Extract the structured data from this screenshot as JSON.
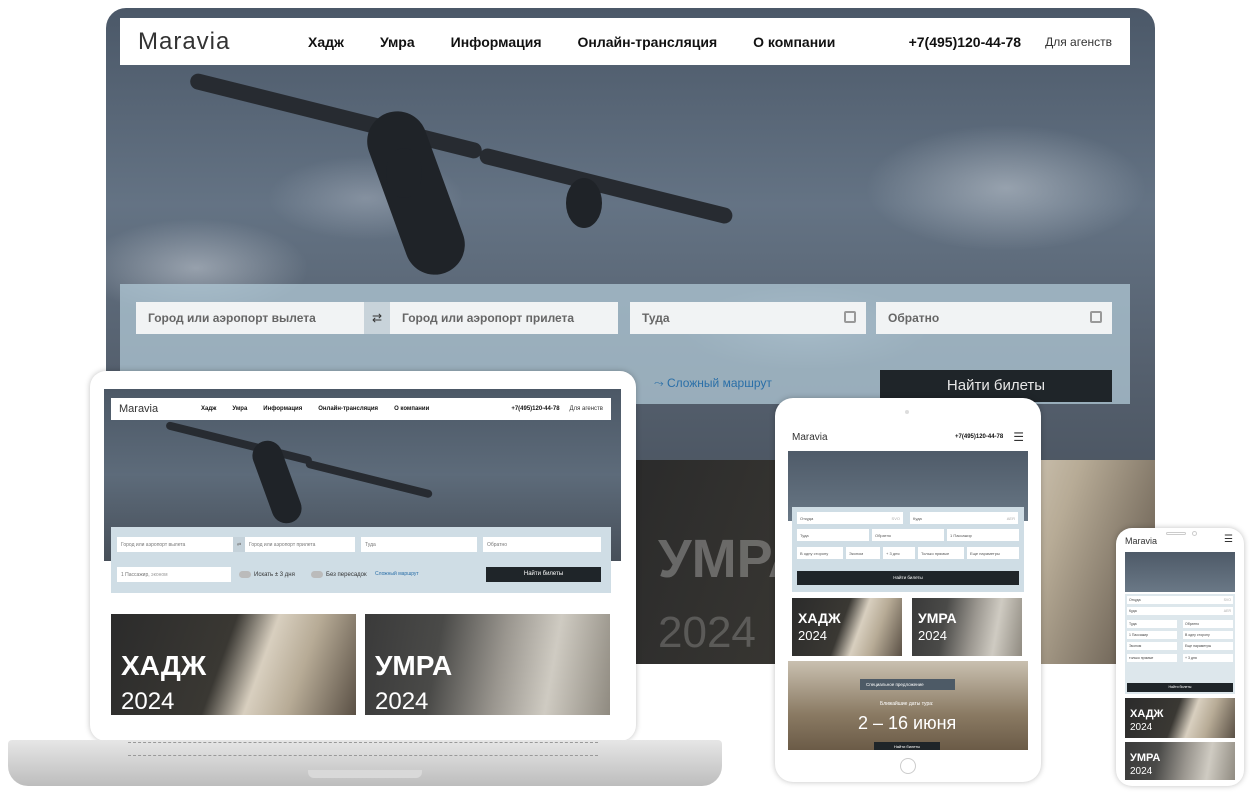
{
  "desktop": {
    "logo": "Maravia",
    "menu": [
      "Хадж",
      "Умра",
      "Информация",
      "Онлайн-трансляция",
      "О компании"
    ],
    "phone": "+7(495)120-44-78",
    "agency": "Для агенств",
    "search": {
      "from_placeholder": "Город или аэропорт вылета",
      "swap_icon": "⇄",
      "to_placeholder": "Город или аэропорт прилета",
      "depart_placeholder": "Туда",
      "return_placeholder": "Обратно",
      "route_link": "Сложный маршрут",
      "find_button": "Найти билеты"
    },
    "umra_title": "УМРА",
    "umra_year": "2024"
  },
  "laptop": {
    "logo": "Maravia",
    "menu": [
      "Хадж",
      "Умра",
      "Информация",
      "Онлайн-трансляция",
      "О компании"
    ],
    "phone": "+7(495)120-44-78",
    "agency": "Для агенств",
    "search": {
      "from_placeholder": "Город или аэропорт вылета",
      "swap_icon": "⇄",
      "to_placeholder": "Город или аэропорт прилета",
      "depart_placeholder": "Туда",
      "return_placeholder": "Обратно",
      "passengers": "1 Пассажир,",
      "class": "эконом",
      "toggle_3days": "Искать ± 3 дня",
      "toggle_direct": "Без пересадок",
      "route_link": "Сложный маршрут",
      "find_button": "Найти билеты"
    },
    "cards": [
      {
        "title": "ХАДЖ",
        "year": "2024"
      },
      {
        "title": "УМРА",
        "year": "2024"
      }
    ]
  },
  "tablet": {
    "logo": "Maravia",
    "phone": "+7(495)120-44-78",
    "search": {
      "from": "Откуда",
      "from_code": "SVO",
      "to": "Куда",
      "to_code": "AER",
      "depart": "Туда",
      "return": "Обратно",
      "passengers": "1 Пассажир",
      "oneway": "В одну сторону",
      "class": "Эконом",
      "plusminus": "+ 3 дня",
      "direct": "Только прямые",
      "more": "Еще параметры",
      "find_button": "Найти билеты"
    },
    "cards": [
      {
        "title": "ХАДЖ",
        "year": "2024"
      },
      {
        "title": "УМРА",
        "year": "2024"
      }
    ],
    "promo": {
      "badge": "Специальное предложение",
      "subtitle": "Ближайшие даты тура:",
      "dates": "2 – 16 июня",
      "button": "Найти билеты"
    }
  },
  "mobile": {
    "logo": "Maravia",
    "search": {
      "from": "Откуда",
      "from_code": "SVO",
      "to": "Куда",
      "to_code": "AER",
      "depart": "Туда",
      "return": "Обратно",
      "passengers": "1 Пассажир",
      "oneway": "В одну сторону",
      "class": "Эконом",
      "more": "Еще параметры",
      "direct": "только прямые",
      "plusminus": "+ 3 дня",
      "find_button": "Найти билеты"
    },
    "cards": [
      {
        "title": "ХАДЖ",
        "year": "2024"
      },
      {
        "title": "УМРА",
        "year": "2024"
      }
    ]
  },
  "colors": {
    "dark_button": "#1f2529",
    "search_panel": "#cfdde5",
    "link": "#2a6fa8"
  }
}
